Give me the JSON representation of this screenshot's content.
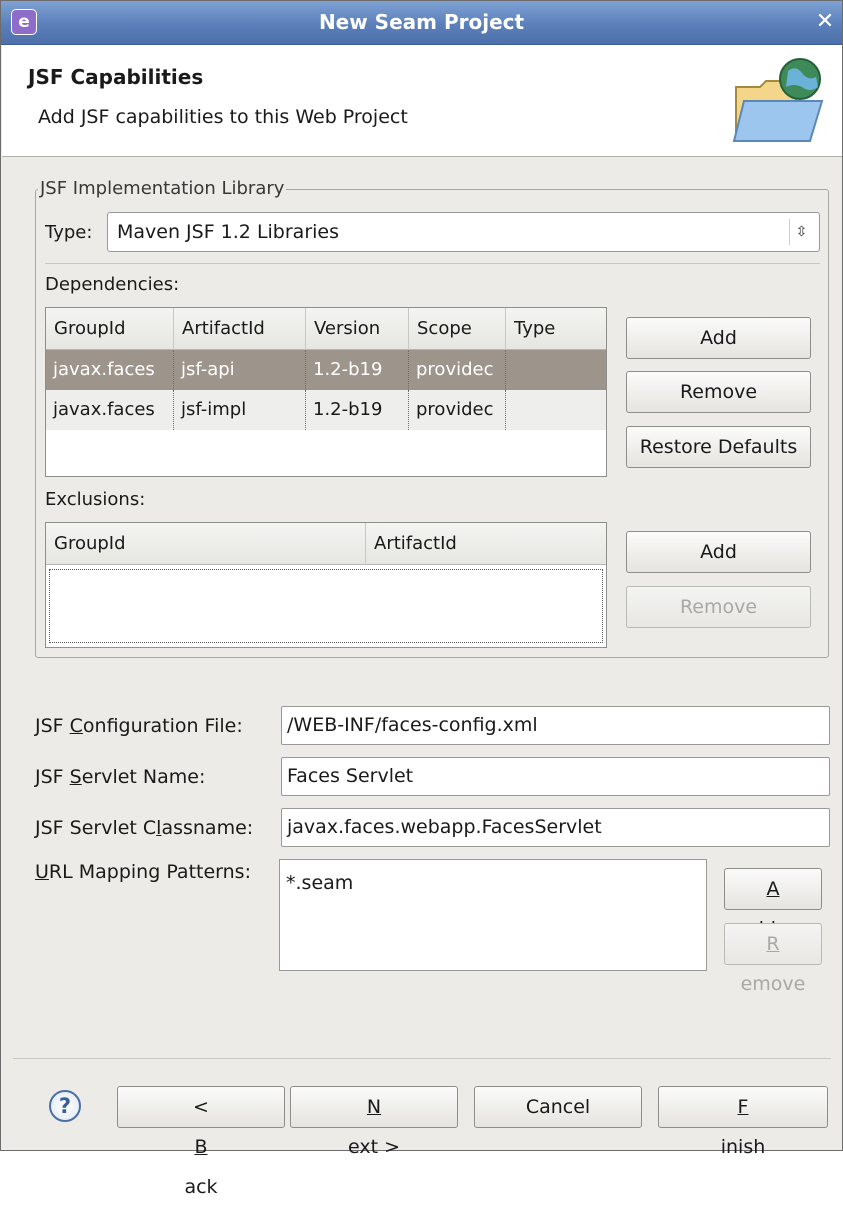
{
  "window": {
    "title": "New Seam Project"
  },
  "header": {
    "title": "JSF Capabilities",
    "description": "Add JSF capabilities to this Web Project"
  },
  "implementation": {
    "group_label": "JSF Implementation Library",
    "type_label": "Type:",
    "type_value": "Maven JSF 1.2 Libraries",
    "dependencies_label": "Dependencies:",
    "dependency_columns": [
      "GroupId",
      "ArtifactId",
      "Version",
      "Scope",
      "Type"
    ],
    "dependency_rows": [
      {
        "group": "javax.faces",
        "artifact": "jsf-api",
        "version": "1.2-b19",
        "scope": "providec",
        "type": ""
      },
      {
        "group": "javax.faces",
        "artifact": "jsf-impl",
        "version": "1.2-b19",
        "scope": "providec",
        "type": ""
      }
    ],
    "dep_add": "Add",
    "dep_remove": "Remove",
    "dep_restore": "Restore Defaults",
    "exclusions_label": "Exclusions:",
    "exclusion_columns": [
      "GroupId",
      "ArtifactId"
    ],
    "exc_add": "Add",
    "exc_remove": "Remove"
  },
  "config": {
    "config_file_label": {
      "pre": "JSF ",
      "mn": "C",
      "post": "onfiguration File:"
    },
    "config_file_value": "/WEB-INF/faces-config.xml",
    "servlet_name_label": {
      "pre": "JSF ",
      "mn": "S",
      "post": "ervlet Name:"
    },
    "servlet_name_value": "Faces Servlet",
    "servlet_class_label": {
      "pre": "JSF Servlet C",
      "mn": "l",
      "post": "assname:"
    },
    "servlet_class_value": "javax.faces.webapp.FacesServlet",
    "url_label": {
      "pre": "",
      "mn": "U",
      "post": "RL Mapping Patterns:"
    },
    "url_patterns": [
      "*.seam"
    ],
    "url_add": {
      "pre": "",
      "mn": "A",
      "post": "dd..."
    },
    "url_remove": {
      "pre": "",
      "mn": "R",
      "post": "emove"
    }
  },
  "footer": {
    "back": {
      "pre": "< ",
      "mn": "B",
      "post": "ack"
    },
    "next": {
      "pre": "",
      "mn": "N",
      "post": "ext >"
    },
    "cancel": "Cancel",
    "finish": {
      "pre": "",
      "mn": "F",
      "post": "inish"
    }
  },
  "colors": {
    "title_bar": "#5b7fb9",
    "selection": "#9d958c",
    "dialog_bg": "#ecebe7"
  },
  "icons": {
    "app": "eclipse-icon",
    "close": "close-icon",
    "banner": "folder-globe-icon",
    "help": "help-icon"
  }
}
